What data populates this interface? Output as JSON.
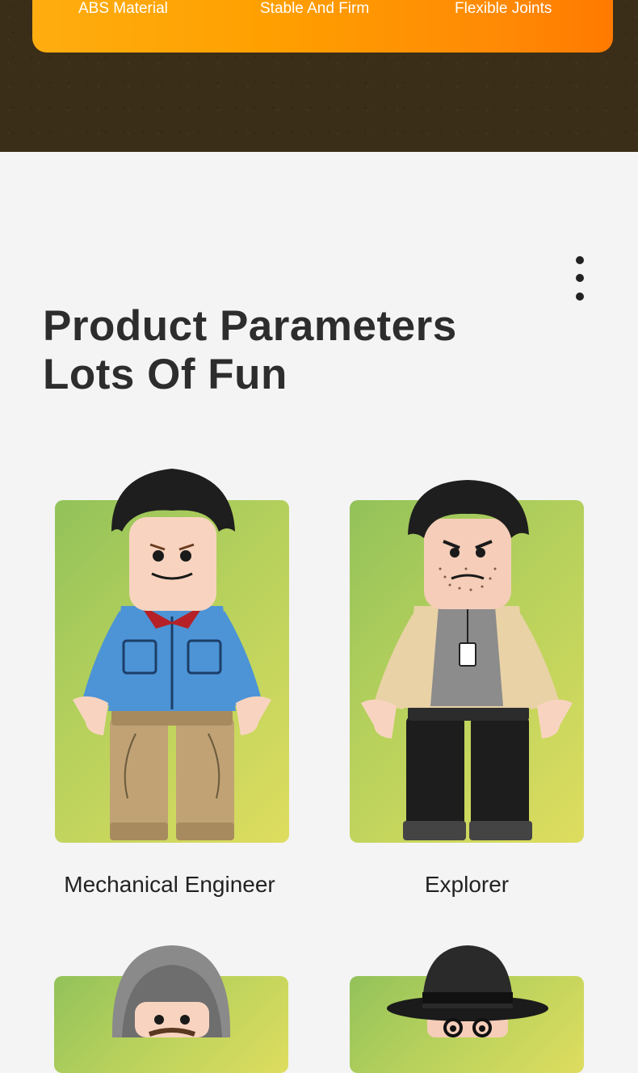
{
  "features": {
    "items": [
      "ABS Material",
      "Stable And Firm",
      "Flexible Joints"
    ]
  },
  "section": {
    "title_line1": "Product Parameters",
    "title_line2": "Lots Of Fun"
  },
  "minifigures": [
    {
      "caption": "Mechanical Engineer"
    },
    {
      "caption": "Explorer"
    },
    {
      "caption": ""
    },
    {
      "caption": ""
    }
  ],
  "icons": {
    "menu": "more-vertical-icon"
  },
  "colors": {
    "top_band": "#3a2e18",
    "orange_start": "#ffad10",
    "orange_end": "#ff7a00",
    "card_green": "#92c25a",
    "card_yellow": "#dedd5f",
    "title_text": "#2d2d2d"
  }
}
